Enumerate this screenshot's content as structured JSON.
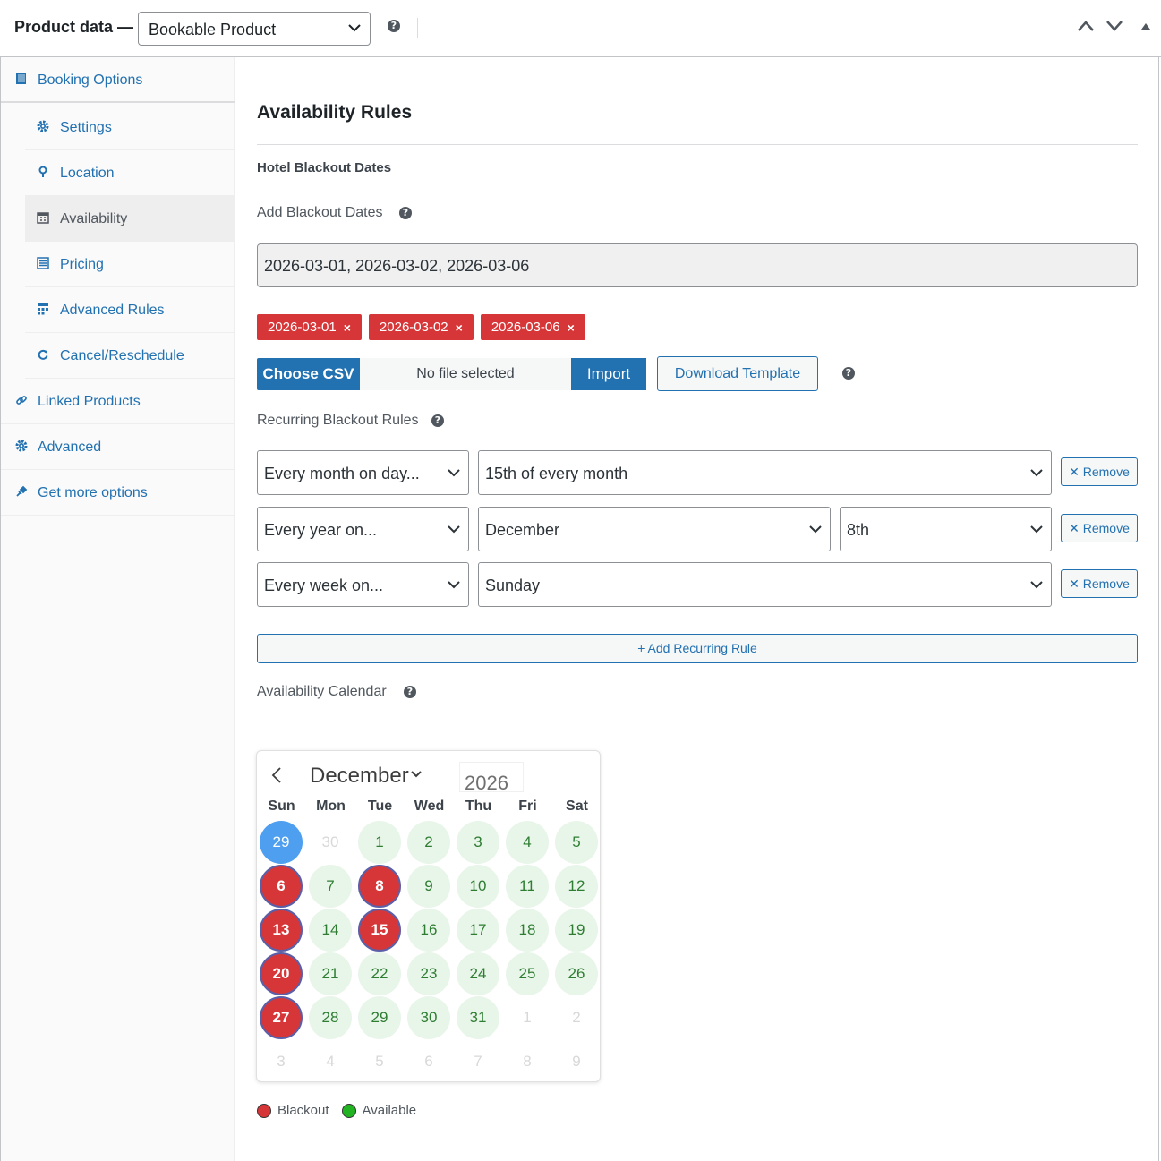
{
  "header": {
    "title": "Product data —",
    "product_type": "Bookable Product"
  },
  "sidebar": {
    "items": [
      {
        "label": "Booking Options",
        "icon": "book-icon"
      },
      {
        "label": "Settings",
        "icon": "gear-icon"
      },
      {
        "label": "Location",
        "icon": "location-pin-icon"
      },
      {
        "label": "Availability",
        "icon": "calendar-icon"
      },
      {
        "label": "Pricing",
        "icon": "list-icon"
      },
      {
        "label": "Advanced Rules",
        "icon": "grid-icon"
      },
      {
        "label": "Cancel/Reschedule",
        "icon": "refresh-icon"
      },
      {
        "label": "Linked Products",
        "icon": "link-icon"
      },
      {
        "label": "Advanced",
        "icon": "gear-icon"
      },
      {
        "label": "Get more options",
        "icon": "plugin-icon"
      }
    ]
  },
  "main": {
    "title": "Availability Rules",
    "section": "Hotel Blackout Dates",
    "add_blackout_label": "Add Blackout Dates",
    "blackout_input_value": "2026-03-01, 2026-03-02, 2026-03-06",
    "tags": [
      "2026-03-01",
      "2026-03-02",
      "2026-03-06"
    ],
    "choose_csv": "Choose CSV",
    "file_status": "No file selected",
    "import": "Import",
    "download_template": "Download Template",
    "recurring_label": "Recurring Blackout Rules",
    "rules": [
      {
        "type": "Every month on day...",
        "value": "15th of every month"
      },
      {
        "type": "Every year on...",
        "month": "December",
        "day": "8th"
      },
      {
        "type": "Every week on...",
        "value": "Sunday"
      }
    ],
    "remove_label": "Remove",
    "add_rule": "+ Add Recurring Rule",
    "calendar_label": "Availability Calendar"
  },
  "calendar": {
    "month": "December",
    "year": "2026",
    "weekdays": [
      "Sun",
      "Mon",
      "Tue",
      "Wed",
      "Thu",
      "Fri",
      "Sat"
    ],
    "weeks": [
      [
        {
          "d": "29",
          "s": "today"
        },
        {
          "d": "30",
          "s": "off"
        },
        {
          "d": "1",
          "s": "av"
        },
        {
          "d": "2",
          "s": "av"
        },
        {
          "d": "3",
          "s": "av"
        },
        {
          "d": "4",
          "s": "av"
        },
        {
          "d": "5",
          "s": "av"
        }
      ],
      [
        {
          "d": "6",
          "s": "bo"
        },
        {
          "d": "7",
          "s": "av"
        },
        {
          "d": "8",
          "s": "bo"
        },
        {
          "d": "9",
          "s": "av"
        },
        {
          "d": "10",
          "s": "av"
        },
        {
          "d": "11",
          "s": "av"
        },
        {
          "d": "12",
          "s": "av"
        }
      ],
      [
        {
          "d": "13",
          "s": "bo"
        },
        {
          "d": "14",
          "s": "av"
        },
        {
          "d": "15",
          "s": "bo"
        },
        {
          "d": "16",
          "s": "av"
        },
        {
          "d": "17",
          "s": "av"
        },
        {
          "d": "18",
          "s": "av"
        },
        {
          "d": "19",
          "s": "av"
        }
      ],
      [
        {
          "d": "20",
          "s": "bo"
        },
        {
          "d": "21",
          "s": "av"
        },
        {
          "d": "22",
          "s": "av"
        },
        {
          "d": "23",
          "s": "av"
        },
        {
          "d": "24",
          "s": "av"
        },
        {
          "d": "25",
          "s": "av"
        },
        {
          "d": "26",
          "s": "av"
        }
      ],
      [
        {
          "d": "27",
          "s": "bo"
        },
        {
          "d": "28",
          "s": "av"
        },
        {
          "d": "29",
          "s": "av"
        },
        {
          "d": "30",
          "s": "av"
        },
        {
          "d": "31",
          "s": "av"
        },
        {
          "d": "1",
          "s": "off"
        },
        {
          "d": "2",
          "s": "off"
        }
      ],
      [
        {
          "d": "3",
          "s": "off"
        },
        {
          "d": "4",
          "s": "off"
        },
        {
          "d": "5",
          "s": "off"
        },
        {
          "d": "6",
          "s": "off"
        },
        {
          "d": "7",
          "s": "off"
        },
        {
          "d": "8",
          "s": "off"
        },
        {
          "d": "9",
          "s": "off"
        }
      ]
    ]
  },
  "legend": {
    "blackout": "Blackout",
    "available": "Available",
    "blackout_color": "#d63638",
    "available_color": "#22b322"
  }
}
